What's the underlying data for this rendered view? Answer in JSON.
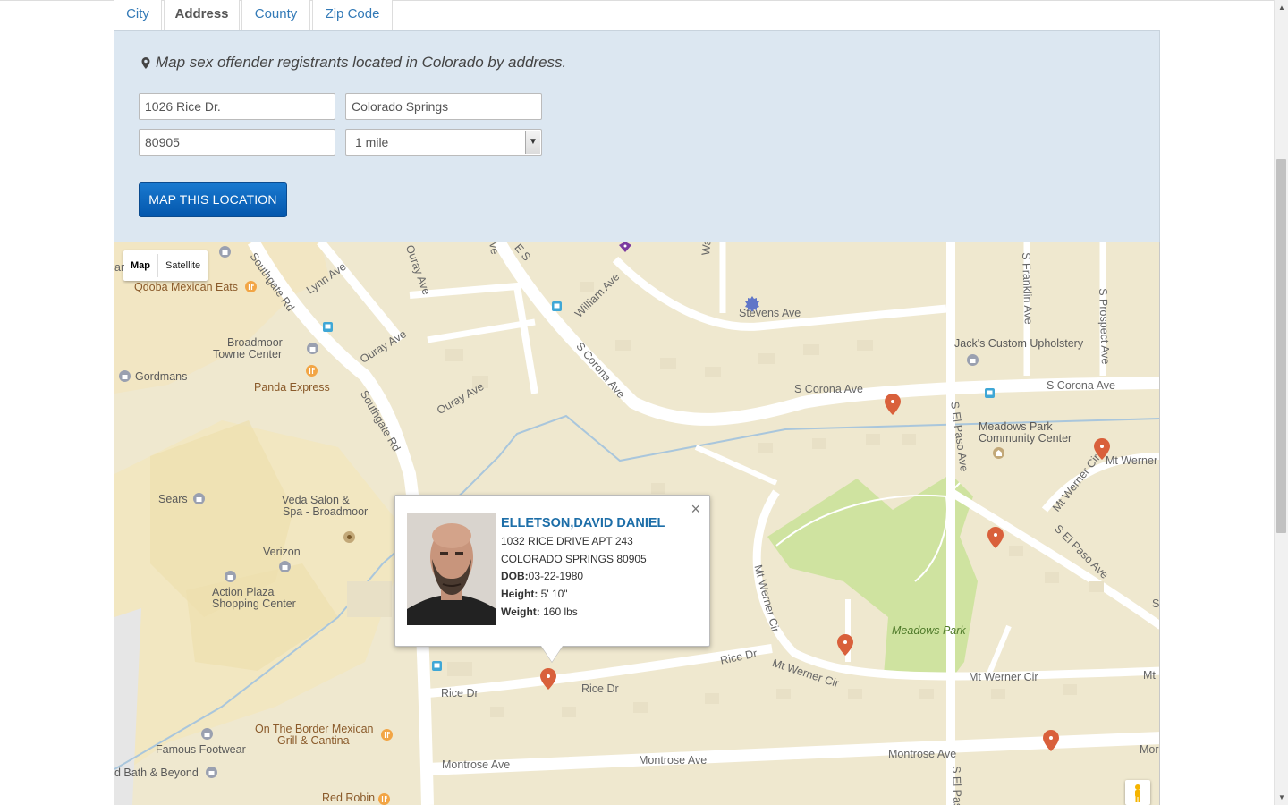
{
  "tabs": [
    {
      "label": "City"
    },
    {
      "label": "Address"
    },
    {
      "label": "County"
    },
    {
      "label": "Zip Code"
    }
  ],
  "form": {
    "heading": "Map sex offender registrants located in Colorado by address.",
    "address": "1026 Rice Dr.",
    "city": "Colorado Springs",
    "zip": "80905",
    "radius": "1 mile",
    "submit_label": "MAP THIS LOCATION"
  },
  "map": {
    "type_controls": {
      "map": "Map",
      "satellite": "Satellite"
    },
    "places": {
      "qdoba": "Qdoba Mexican Eats",
      "broadmoor_towne_1": "Broadmoor",
      "broadmoor_towne_2": "Towne Center",
      "panda": "Panda Express",
      "gordmans": "Gordmans",
      "sears": "Sears",
      "veda_1": "Veda Salon &",
      "veda_2": "Spa - Broadmoor",
      "verizon": "Verizon",
      "action_plaza_1": "Action Plaza",
      "action_plaza_2": "Shopping Center",
      "on_the_border_1": "On The Border Mexican",
      "on_the_border_2": "Grill & Cantina",
      "famous_footwear": "Famous Footwear",
      "bed_bath": "d Bath & Beyond",
      "red_robin": "Red Robin",
      "jacks": "Jack's Custom Upholstery",
      "meadows_cc_1": "Meadows Park",
      "meadows_cc_2": "Community Center",
      "meadows_park": "Meadows Park"
    },
    "streets": {
      "southgate_1": "Southgate Rd",
      "southgate_2": "Southgate Rd",
      "lynn": "Lynn Ave",
      "ouray_1": "Ouray Ave",
      "ouray_2": "Ouray Ave",
      "ouray_3": "Ouray Ave",
      "william": "William Ave",
      "corona_diag": "S Corona Ave",
      "corona_1": "S Corona Ave",
      "corona_2": "S Corona Ave",
      "warren": "Warren Ave",
      "stevens": "Stevens Ave",
      "franklin": "S Franklin Ave",
      "prospect": "S Prospect Ave",
      "el_paso_1": "S El Paso Ave",
      "el_paso_2": "S El Paso Ave",
      "el_paso_3": "S El Paso",
      "mt_werner_1": "Mt Werner Cir",
      "mt_werner_2": "Mt Werner",
      "mt_werner_3": "Mt Werner Cir",
      "mt_werner_4": "Mt Werner Cir",
      "mt_werner_5": "Mt Werner Cir",
      "mt_short": "Mt",
      "rice_1": "Rice Dr",
      "rice_2": "Rice Dr",
      "rice_3": "Rice Dr",
      "montrose_1": "Montrose Ave",
      "montrose_2": "Montrose Ave",
      "montrose_3": "Montrose Ave",
      "montrose_4": "Mor",
      "s_partial": "S",
      "e_partial": "E S",
      "ve_partial": "ve",
      "ar_partial": "ar"
    }
  },
  "offender": {
    "name": "ELLETSON,DAVID DANIEL",
    "address_line1": "1032 RICE DRIVE APT 243",
    "address_line2": "COLORADO SPRINGS 80905",
    "dob_label": "DOB:",
    "dob": "03-22-1980",
    "height_label": "Height:",
    "height": " 5' 10\"",
    "weight_label": "Weight:",
    "weight": " 160 lbs"
  },
  "colors": {
    "tab_link": "#337ab7",
    "panel_bg": "#dce7f1",
    "button": "#0a63bf",
    "marker": "#d9603b",
    "map_bg": "#efe8cf",
    "park": "#cfe3a0"
  }
}
